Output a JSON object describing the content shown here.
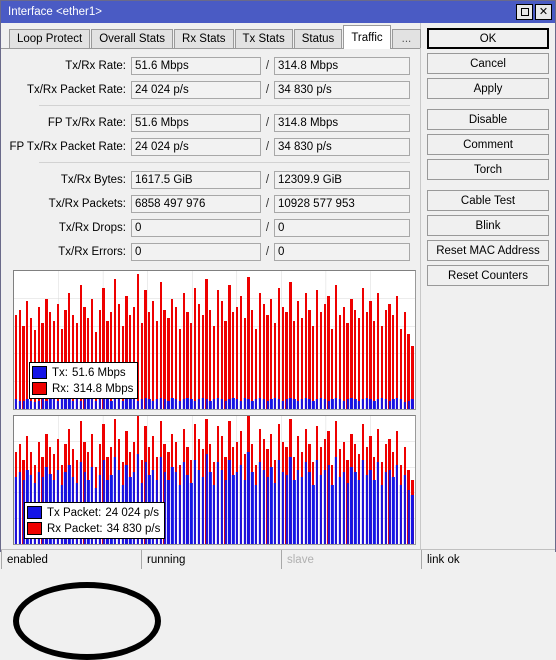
{
  "window": {
    "title": "Interface <ether1>",
    "controls": [
      {
        "name": "maximize-button",
        "glyph": "square"
      },
      {
        "name": "close-button",
        "glyph": "✕"
      }
    ]
  },
  "tabs": [
    {
      "label": "Loop Protect",
      "active": false
    },
    {
      "label": "Overall Stats",
      "active": false
    },
    {
      "label": "Rx Stats",
      "active": false
    },
    {
      "label": "Tx Stats",
      "active": false
    },
    {
      "label": "Status",
      "active": false
    },
    {
      "label": "Traffic",
      "active": true
    },
    {
      "label": "...",
      "active": false
    }
  ],
  "fields": {
    "group1": [
      {
        "label": "Tx/Rx Rate:",
        "tx": "51.6 Mbps",
        "rx": "314.8 Mbps"
      },
      {
        "label": "Tx/Rx Packet Rate:",
        "tx": "24 024 p/s",
        "rx": "34 830 p/s"
      }
    ],
    "group2": [
      {
        "label": "FP Tx/Rx Rate:",
        "tx": "51.6 Mbps",
        "rx": "314.8 Mbps"
      },
      {
        "label": "FP Tx/Rx Packet Rate:",
        "tx": "24 024 p/s",
        "rx": "34 830 p/s"
      }
    ],
    "group3": [
      {
        "label": "Tx/Rx Bytes:",
        "tx": "1617.5 GiB",
        "rx": "12309.9 GiB"
      },
      {
        "label": "Tx/Rx Packets:",
        "tx": "6858 497 976",
        "rx": "10928 577 953"
      },
      {
        "label": "Tx/Rx Drops:",
        "tx": "0",
        "rx": "0"
      },
      {
        "label": "Tx/Rx Errors:",
        "tx": "0",
        "rx": "0"
      }
    ],
    "separator": "/"
  },
  "buttons": [
    {
      "label": "OK",
      "default": true,
      "gap": false
    },
    {
      "label": "Cancel",
      "default": false,
      "gap": false
    },
    {
      "label": "Apply",
      "default": false,
      "gap": false
    },
    {
      "label": "Disable",
      "default": false,
      "gap": true
    },
    {
      "label": "Comment",
      "default": false,
      "gap": false
    },
    {
      "label": "Torch",
      "default": false,
      "gap": false
    },
    {
      "label": "Cable Test",
      "default": false,
      "gap": true
    },
    {
      "label": "Blink",
      "default": false,
      "gap": false
    },
    {
      "label": "Reset MAC Address",
      "default": false,
      "gap": false
    },
    {
      "label": "Reset Counters",
      "default": false,
      "gap": false
    }
  ],
  "statusbar": [
    {
      "label": "enabled",
      "dimmed": false
    },
    {
      "label": "running",
      "dimmed": false
    },
    {
      "label": "slave",
      "dimmed": true
    },
    {
      "label": "link ok",
      "dimmed": false
    }
  ],
  "colors": {
    "tx": "#1414e6",
    "rx": "#ee0000",
    "titlebar": "#4a5bc4",
    "annotation": "#000000",
    "grid": "#d8d8d8"
  },
  "annotation": {
    "shape": "ellipse",
    "target": "rate-legend",
    "color": "#000000"
  },
  "chart_data": [
    {
      "type": "bar",
      "id": "rate-chart",
      "title": "",
      "xlabel": "",
      "ylabel": "",
      "grid": true,
      "legend_position": "bottom-left",
      "series": [
        {
          "name": "Tx",
          "legend_label": "Tx:",
          "legend_value": "51.6 Mbps",
          "color": "#1414e6",
          "values": [
            7,
            6,
            6,
            7,
            6,
            5,
            6,
            7,
            6,
            8,
            7,
            6,
            7,
            8,
            7,
            6,
            7,
            6,
            7,
            8,
            7,
            6,
            7,
            8,
            7,
            6,
            8,
            7,
            6,
            7,
            8,
            7,
            6,
            7,
            8,
            7,
            6,
            7,
            8,
            7,
            6,
            8,
            7,
            6,
            7,
            8,
            7,
            6,
            7,
            8,
            7,
            6,
            7,
            8,
            7,
            6,
            7,
            8,
            7,
            6,
            8,
            7,
            6,
            7,
            8,
            7,
            6,
            7,
            8,
            7,
            6,
            7,
            8,
            7,
            6,
            7,
            8,
            7,
            6,
            7,
            8,
            7,
            6,
            7,
            8,
            7,
            6,
            7,
            8,
            7,
            6,
            7,
            8,
            7,
            6,
            7,
            8,
            7,
            6,
            7,
            8,
            7,
            5,
            6,
            7
          ]
        },
        {
          "name": "Rx",
          "legend_label": "Rx:",
          "legend_value": "314.8 Mbps",
          "color": "#ee0000",
          "values": [
            68,
            72,
            60,
            78,
            66,
            57,
            74,
            62,
            80,
            70,
            64,
            76,
            58,
            72,
            84,
            68,
            62,
            90,
            74,
            66,
            80,
            56,
            72,
            88,
            64,
            70,
            94,
            76,
            60,
            82,
            68,
            74,
            98,
            62,
            86,
            70,
            78,
            64,
            92,
            72,
            66,
            80,
            74,
            58,
            84,
            70,
            62,
            88,
            76,
            68,
            94,
            72,
            60,
            86,
            78,
            64,
            90,
            70,
            74,
            82,
            66,
            96,
            72,
            58,
            84,
            76,
            68,
            80,
            62,
            88,
            74,
            70,
            92,
            64,
            78,
            66,
            84,
            72,
            60,
            86,
            70,
            76,
            82,
            58,
            90,
            68,
            74,
            62,
            80,
            72,
            66,
            88,
            70,
            78,
            64,
            84,
            60,
            72,
            76,
            68,
            82,
            58,
            70,
            54,
            46
          ]
        }
      ],
      "ylim": [
        0,
        100
      ]
    },
    {
      "type": "bar",
      "id": "packet-chart",
      "title": "",
      "xlabel": "",
      "ylabel": "",
      "grid": true,
      "legend_position": "bottom-left",
      "series": [
        {
          "name": "Tx Packet",
          "legend_label": "Tx Packet:",
          "legend_value": "24 024 p/s",
          "color": "#1414e6",
          "values": [
            52,
            56,
            50,
            58,
            54,
            48,
            56,
            52,
            60,
            55,
            50,
            58,
            46,
            56,
            62,
            52,
            48,
            64,
            56,
            50,
            60,
            44,
            54,
            66,
            50,
            54,
            68,
            58,
            46,
            62,
            52,
            56,
            70,
            48,
            64,
            54,
            58,
            50,
            68,
            56,
            50,
            60,
            56,
            46,
            64,
            54,
            48,
            66,
            58,
            52,
            70,
            56,
            46,
            64,
            58,
            50,
            66,
            54,
            56,
            62,
            50,
            72,
            56,
            46,
            64,
            58,
            52,
            60,
            48,
            66,
            56,
            54,
            68,
            50,
            58,
            52,
            64,
            56,
            46,
            66,
            54,
            58,
            62,
            46,
            68,
            52,
            56,
            48,
            60,
            56,
            50,
            66,
            54,
            58,
            50,
            64,
            46,
            56,
            58,
            52,
            62,
            46,
            54,
            42,
            38
          ]
        },
        {
          "name": "Rx Packet",
          "legend_label": "Rx Packet:",
          "legend_value": "34 830 p/s",
          "color": "#ee0000",
          "values": [
            72,
            78,
            66,
            84,
            72,
            62,
            80,
            68,
            86,
            76,
            70,
            82,
            62,
            78,
            90,
            74,
            66,
            96,
            80,
            72,
            86,
            60,
            78,
            94,
            68,
            76,
            98,
            82,
            64,
            88,
            72,
            80,
            100,
            66,
            92,
            76,
            84,
            68,
            96,
            78,
            72,
            86,
            80,
            62,
            90,
            76,
            66,
            94,
            82,
            74,
            98,
            78,
            64,
            92,
            84,
            68,
            96,
            76,
            80,
            88,
            70,
            100,
            78,
            62,
            90,
            82,
            74,
            86,
            66,
            94,
            80,
            76,
            98,
            68,
            84,
            72,
            90,
            78,
            64,
            92,
            76,
            82,
            88,
            62,
            96,
            74,
            80,
            66,
            86,
            78,
            70,
            94,
            76,
            84,
            68,
            90,
            64,
            78,
            82,
            72,
            88,
            62,
            76,
            58,
            50
          ]
        }
      ],
      "ylim": [
        0,
        100
      ]
    }
  ]
}
